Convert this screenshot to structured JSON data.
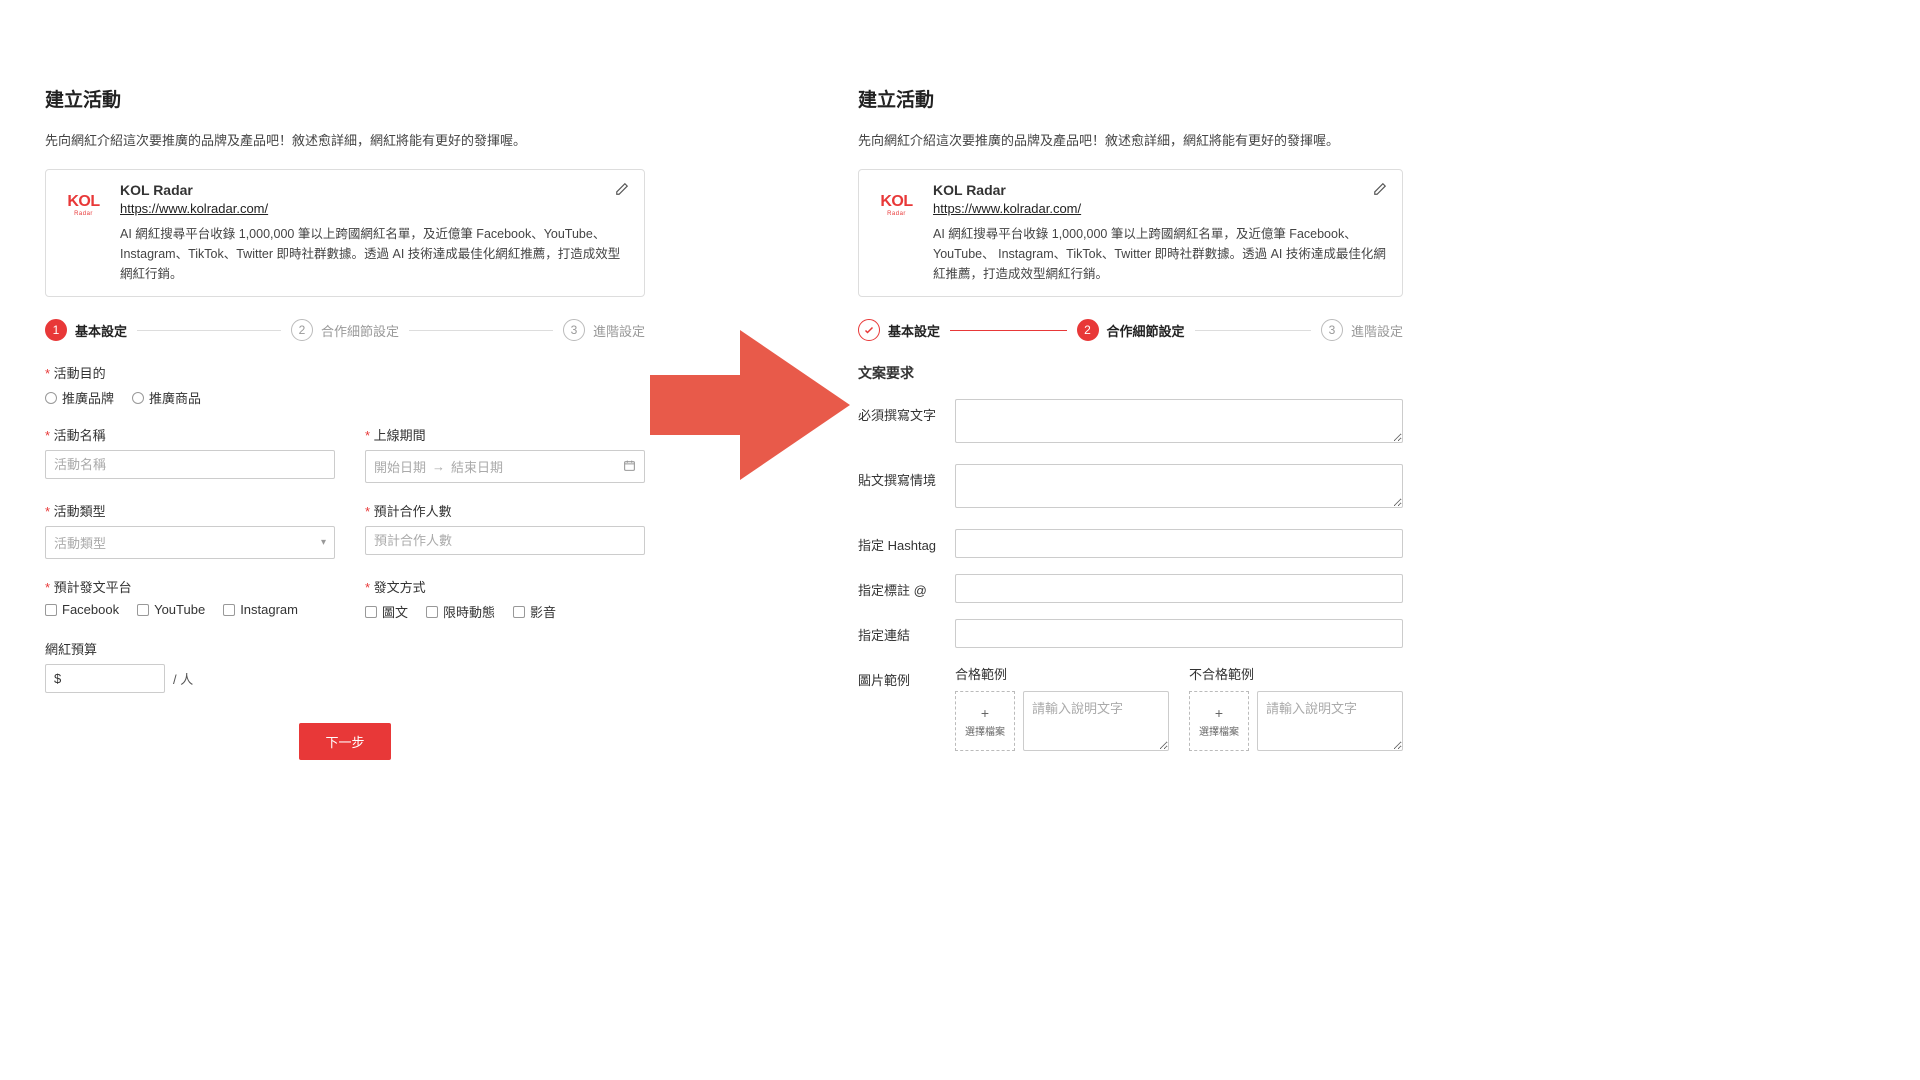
{
  "header": {
    "title": "建立活動",
    "subtitle": "先向網紅介紹這次要推廣的品牌及產品吧！敘述愈詳細，網紅將能有更好的發揮喔。"
  },
  "card": {
    "brand": "KOL Radar",
    "url": "https://www.kolradar.com/",
    "desc": "AI 網紅搜尋平台收錄 1,000,000 筆以上跨國網紅名單，及近億筆 Facebook、YouTube、 Instagram、TikTok、Twitter 即時社群數據。透過 AI 技術達成最佳化網紅推薦，打造成效型網紅行銷。",
    "logo_main": "KOL",
    "logo_sub": "Radar"
  },
  "stepper": {
    "step1": "基本設定",
    "step2": "合作細節設定",
    "step3": "進階設定",
    "num1": "1",
    "num2": "2",
    "num3": "3"
  },
  "left": {
    "purpose_label": "活動目的",
    "purpose_opt1": "推廣品牌",
    "purpose_opt2": "推廣商品",
    "name_label": "活動名稱",
    "name_ph": "活動名稱",
    "period_label": "上線期間",
    "period_start": "開始日期",
    "period_end": "結束日期",
    "period_arrow": "→",
    "type_label": "活動類型",
    "type_ph": "活動類型",
    "people_label": "預計合作人數",
    "people_ph": "預計合作人數",
    "platform_label": "預計發文平台",
    "platform_fb": "Facebook",
    "platform_yt": "YouTube",
    "platform_ig": "Instagram",
    "method_label": "發文方式",
    "method_1": "圖文",
    "method_2": "限時動態",
    "method_3": "影音",
    "budget_label": "網紅預算",
    "budget_prefix": "$",
    "budget_unit": "/ 人",
    "next": "下一步"
  },
  "right": {
    "section": "文案要求",
    "f1": "必須撰寫文字",
    "f2": "貼文撰寫情境",
    "f3": "指定 Hashtag",
    "f4": "指定標註 @",
    "f5": "指定連結",
    "f6": "圖片範例",
    "good": "合格範例",
    "bad": "不合格範例",
    "upload": "選擇檔案",
    "upload_ph": "請輸入說明文字",
    "plus": "+"
  }
}
